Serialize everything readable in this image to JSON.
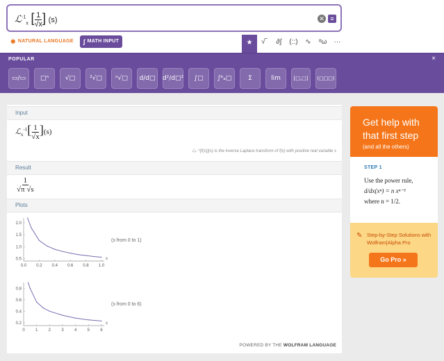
{
  "query": {
    "operator": "ℒ",
    "sup": "-1",
    "sub": "x",
    "numerator": "1",
    "denominator": "√x",
    "argument": "(s)",
    "clear_icon": "close-circle-icon",
    "menu_icon": "menu-icon"
  },
  "modes": {
    "natural": "NATURAL LANGUAGE",
    "math": "MATH INPUT"
  },
  "symbols": [
    "★",
    "√‾",
    "∂∫",
    "(::)",
    "∿",
    "ᵅω",
    "···"
  ],
  "palette": {
    "title": "POPULAR",
    "close": "×",
    "buttons": [
      "▭/▭",
      "□ⁿ",
      "√□",
      "²√□",
      "ⁿ√□",
      "d/d□",
      "d²/d□²",
      "∫□",
      "∫ᵇₐ□",
      "Σ",
      "lim",
      "[□,□]",
      "(□□□)"
    ]
  },
  "input": {
    "header": "Input",
    "numerator": "1",
    "denominator": "√x",
    "argument": "(s)",
    "note": "ℒₓ⁻¹[f(x)](s) is the inverse Laplace transform of f(x) with positive real variable s"
  },
  "result": {
    "header": "Result",
    "numerator": "1",
    "denominator": "√π √s"
  },
  "plots": {
    "header": "Plots",
    "plot1_range": "(s from 0 to 1)",
    "plot2_range": "(s from 0 to 6)",
    "axis_var": "s",
    "plot1_xticks": [
      "0.0",
      "0.2",
      "0.4",
      "0.6",
      "0.8",
      "1.0"
    ],
    "plot1_yticks": [
      "2.0",
      "1.5",
      "1.0",
      "0.5"
    ],
    "plot2_xticks": [
      "0",
      "1",
      "2",
      "3",
      "4",
      "5",
      "6"
    ],
    "plot2_yticks": [
      "0.8",
      "0.6",
      "0.4",
      "0.2"
    ]
  },
  "chart_data": [
    {
      "type": "line",
      "xlim": [
        0,
        1
      ],
      "ylim": [
        0.4,
        2.2
      ],
      "xlabel": "s",
      "function": "1/(sqrt(pi) sqrt(s))",
      "x": [
        0.05,
        0.1,
        0.2,
        0.3,
        0.4,
        0.5,
        0.6,
        0.7,
        0.8,
        0.9,
        1.0
      ],
      "y": [
        2.52,
        1.78,
        1.26,
        1.03,
        0.89,
        0.8,
        0.73,
        0.67,
        0.63,
        0.59,
        0.56
      ]
    },
    {
      "type": "line",
      "xlim": [
        0,
        6
      ],
      "ylim": [
        0.15,
        0.9
      ],
      "xlabel": "s",
      "function": "1/(sqrt(pi) sqrt(s))",
      "x": [
        0.35,
        0.5,
        1,
        1.5,
        2,
        3,
        4,
        5,
        6
      ],
      "y": [
        0.95,
        0.8,
        0.56,
        0.46,
        0.4,
        0.33,
        0.28,
        0.25,
        0.23
      ]
    }
  ],
  "footer": {
    "powered_prefix": "POWERED BY THE",
    "powered_brand": "WOLFRAM LANGUAGE"
  },
  "promo": {
    "title": "Get help with that first step",
    "subtitle": "(and all the others)",
    "step_label": "STEP 1",
    "step_line1": "Use the power rule,",
    "step_formula": "d/dx(xⁿ) = n xⁿ⁻¹",
    "step_line3": "where n = 1/2.",
    "foot_text": "Step-by-Step Solutions with Wolfram|Alpha Pro",
    "go_pro": "Go Pro »",
    "colors": {
      "orange": "#f5761a",
      "purple": "#6a4c9c",
      "cream": "#fbd786"
    }
  }
}
